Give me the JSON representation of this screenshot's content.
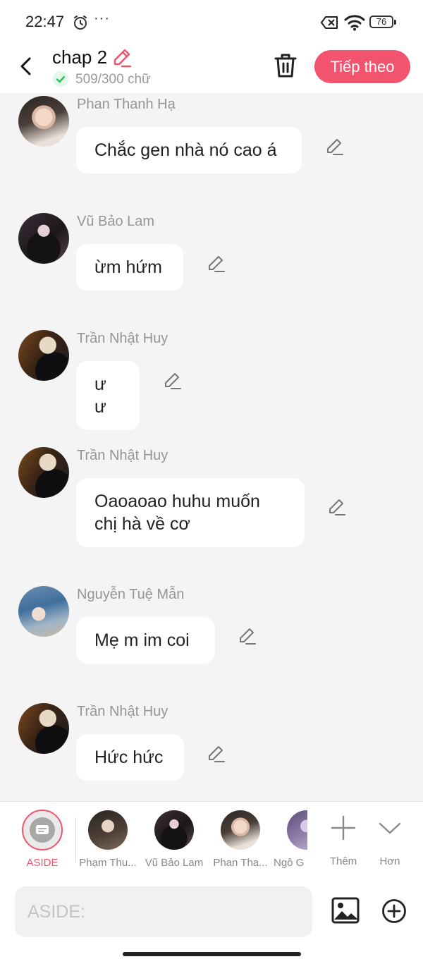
{
  "status_bar": {
    "time": "22:47",
    "dots": "···",
    "battery": "76"
  },
  "header": {
    "title": "chap 2",
    "word_count": "509/300 chữ",
    "next_button": "Tiếp theo"
  },
  "messages": [
    {
      "sender": "Phan Thanh Hạ",
      "text": "Chắc gen nhà nó cao á"
    },
    {
      "sender": "Vũ Bảo Lam",
      "text": "ừm hứm"
    },
    {
      "sender": "Trần Nhật Huy",
      "text": "ư ư"
    },
    {
      "sender": "Trần Nhật Huy",
      "text": "Oaoaoao huhu muốn chị hà về cơ"
    },
    {
      "sender": "Nguyễn Tuệ Mẫn",
      "text": "Mẹ m im coi"
    },
    {
      "sender": "Trần Nhật Huy",
      "text": "Hức hức"
    }
  ],
  "character_bar": {
    "aside_label": "ASIDE",
    "characters": [
      {
        "name": "Phạm Thu..."
      },
      {
        "name": "Vũ Bảo Lam"
      },
      {
        "name": "Phan Tha..."
      },
      {
        "name": "Ngô G"
      }
    ],
    "add_label": "Thêm",
    "more_label": "Hơn"
  },
  "input": {
    "placeholder": "ASIDE:"
  },
  "icons": {
    "status": [
      "alarm-icon",
      "sim-off-icon",
      "wifi-icon",
      "battery-icon"
    ],
    "header": [
      "back-icon",
      "edit-title-icon",
      "check-icon",
      "trash-icon"
    ],
    "message": "pencil-icon",
    "bottom": [
      "aside-icon",
      "plus-icon",
      "chevron-down-icon",
      "image-icon",
      "plus-circle-icon"
    ]
  },
  "colors": {
    "accent": "#f2546d",
    "background": "#f4f4f4",
    "bubble": "#ffffff",
    "check": "#2fbf63"
  }
}
